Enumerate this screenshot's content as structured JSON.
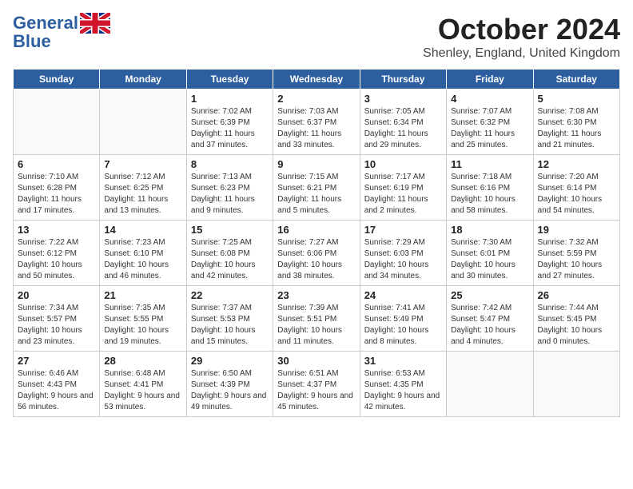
{
  "header": {
    "logo_general": "General",
    "logo_blue": "Blue",
    "month_title": "October 2024",
    "location": "Shenley, England, United Kingdom"
  },
  "weekdays": [
    "Sunday",
    "Monday",
    "Tuesday",
    "Wednesday",
    "Thursday",
    "Friday",
    "Saturday"
  ],
  "weeks": [
    [
      {
        "day": "",
        "sunrise": "",
        "sunset": "",
        "daylight": ""
      },
      {
        "day": "",
        "sunrise": "",
        "sunset": "",
        "daylight": ""
      },
      {
        "day": "1",
        "sunrise": "Sunrise: 7:02 AM",
        "sunset": "Sunset: 6:39 PM",
        "daylight": "Daylight: 11 hours and 37 minutes."
      },
      {
        "day": "2",
        "sunrise": "Sunrise: 7:03 AM",
        "sunset": "Sunset: 6:37 PM",
        "daylight": "Daylight: 11 hours and 33 minutes."
      },
      {
        "day": "3",
        "sunrise": "Sunrise: 7:05 AM",
        "sunset": "Sunset: 6:34 PM",
        "daylight": "Daylight: 11 hours and 29 minutes."
      },
      {
        "day": "4",
        "sunrise": "Sunrise: 7:07 AM",
        "sunset": "Sunset: 6:32 PM",
        "daylight": "Daylight: 11 hours and 25 minutes."
      },
      {
        "day": "5",
        "sunrise": "Sunrise: 7:08 AM",
        "sunset": "Sunset: 6:30 PM",
        "daylight": "Daylight: 11 hours and 21 minutes."
      }
    ],
    [
      {
        "day": "6",
        "sunrise": "Sunrise: 7:10 AM",
        "sunset": "Sunset: 6:28 PM",
        "daylight": "Daylight: 11 hours and 17 minutes."
      },
      {
        "day": "7",
        "sunrise": "Sunrise: 7:12 AM",
        "sunset": "Sunset: 6:25 PM",
        "daylight": "Daylight: 11 hours and 13 minutes."
      },
      {
        "day": "8",
        "sunrise": "Sunrise: 7:13 AM",
        "sunset": "Sunset: 6:23 PM",
        "daylight": "Daylight: 11 hours and 9 minutes."
      },
      {
        "day": "9",
        "sunrise": "Sunrise: 7:15 AM",
        "sunset": "Sunset: 6:21 PM",
        "daylight": "Daylight: 11 hours and 5 minutes."
      },
      {
        "day": "10",
        "sunrise": "Sunrise: 7:17 AM",
        "sunset": "Sunset: 6:19 PM",
        "daylight": "Daylight: 11 hours and 2 minutes."
      },
      {
        "day": "11",
        "sunrise": "Sunrise: 7:18 AM",
        "sunset": "Sunset: 6:16 PM",
        "daylight": "Daylight: 10 hours and 58 minutes."
      },
      {
        "day": "12",
        "sunrise": "Sunrise: 7:20 AM",
        "sunset": "Sunset: 6:14 PM",
        "daylight": "Daylight: 10 hours and 54 minutes."
      }
    ],
    [
      {
        "day": "13",
        "sunrise": "Sunrise: 7:22 AM",
        "sunset": "Sunset: 6:12 PM",
        "daylight": "Daylight: 10 hours and 50 minutes."
      },
      {
        "day": "14",
        "sunrise": "Sunrise: 7:23 AM",
        "sunset": "Sunset: 6:10 PM",
        "daylight": "Daylight: 10 hours and 46 minutes."
      },
      {
        "day": "15",
        "sunrise": "Sunrise: 7:25 AM",
        "sunset": "Sunset: 6:08 PM",
        "daylight": "Daylight: 10 hours and 42 minutes."
      },
      {
        "day": "16",
        "sunrise": "Sunrise: 7:27 AM",
        "sunset": "Sunset: 6:06 PM",
        "daylight": "Daylight: 10 hours and 38 minutes."
      },
      {
        "day": "17",
        "sunrise": "Sunrise: 7:29 AM",
        "sunset": "Sunset: 6:03 PM",
        "daylight": "Daylight: 10 hours and 34 minutes."
      },
      {
        "day": "18",
        "sunrise": "Sunrise: 7:30 AM",
        "sunset": "Sunset: 6:01 PM",
        "daylight": "Daylight: 10 hours and 30 minutes."
      },
      {
        "day": "19",
        "sunrise": "Sunrise: 7:32 AM",
        "sunset": "Sunset: 5:59 PM",
        "daylight": "Daylight: 10 hours and 27 minutes."
      }
    ],
    [
      {
        "day": "20",
        "sunrise": "Sunrise: 7:34 AM",
        "sunset": "Sunset: 5:57 PM",
        "daylight": "Daylight: 10 hours and 23 minutes."
      },
      {
        "day": "21",
        "sunrise": "Sunrise: 7:35 AM",
        "sunset": "Sunset: 5:55 PM",
        "daylight": "Daylight: 10 hours and 19 minutes."
      },
      {
        "day": "22",
        "sunrise": "Sunrise: 7:37 AM",
        "sunset": "Sunset: 5:53 PM",
        "daylight": "Daylight: 10 hours and 15 minutes."
      },
      {
        "day": "23",
        "sunrise": "Sunrise: 7:39 AM",
        "sunset": "Sunset: 5:51 PM",
        "daylight": "Daylight: 10 hours and 11 minutes."
      },
      {
        "day": "24",
        "sunrise": "Sunrise: 7:41 AM",
        "sunset": "Sunset: 5:49 PM",
        "daylight": "Daylight: 10 hours and 8 minutes."
      },
      {
        "day": "25",
        "sunrise": "Sunrise: 7:42 AM",
        "sunset": "Sunset: 5:47 PM",
        "daylight": "Daylight: 10 hours and 4 minutes."
      },
      {
        "day": "26",
        "sunrise": "Sunrise: 7:44 AM",
        "sunset": "Sunset: 5:45 PM",
        "daylight": "Daylight: 10 hours and 0 minutes."
      }
    ],
    [
      {
        "day": "27",
        "sunrise": "Sunrise: 6:46 AM",
        "sunset": "Sunset: 4:43 PM",
        "daylight": "Daylight: 9 hours and 56 minutes."
      },
      {
        "day": "28",
        "sunrise": "Sunrise: 6:48 AM",
        "sunset": "Sunset: 4:41 PM",
        "daylight": "Daylight: 9 hours and 53 minutes."
      },
      {
        "day": "29",
        "sunrise": "Sunrise: 6:50 AM",
        "sunset": "Sunset: 4:39 PM",
        "daylight": "Daylight: 9 hours and 49 minutes."
      },
      {
        "day": "30",
        "sunrise": "Sunrise: 6:51 AM",
        "sunset": "Sunset: 4:37 PM",
        "daylight": "Daylight: 9 hours and 45 minutes."
      },
      {
        "day": "31",
        "sunrise": "Sunrise: 6:53 AM",
        "sunset": "Sunset: 4:35 PM",
        "daylight": "Daylight: 9 hours and 42 minutes."
      },
      {
        "day": "",
        "sunrise": "",
        "sunset": "",
        "daylight": ""
      },
      {
        "day": "",
        "sunrise": "",
        "sunset": "",
        "daylight": ""
      }
    ]
  ]
}
